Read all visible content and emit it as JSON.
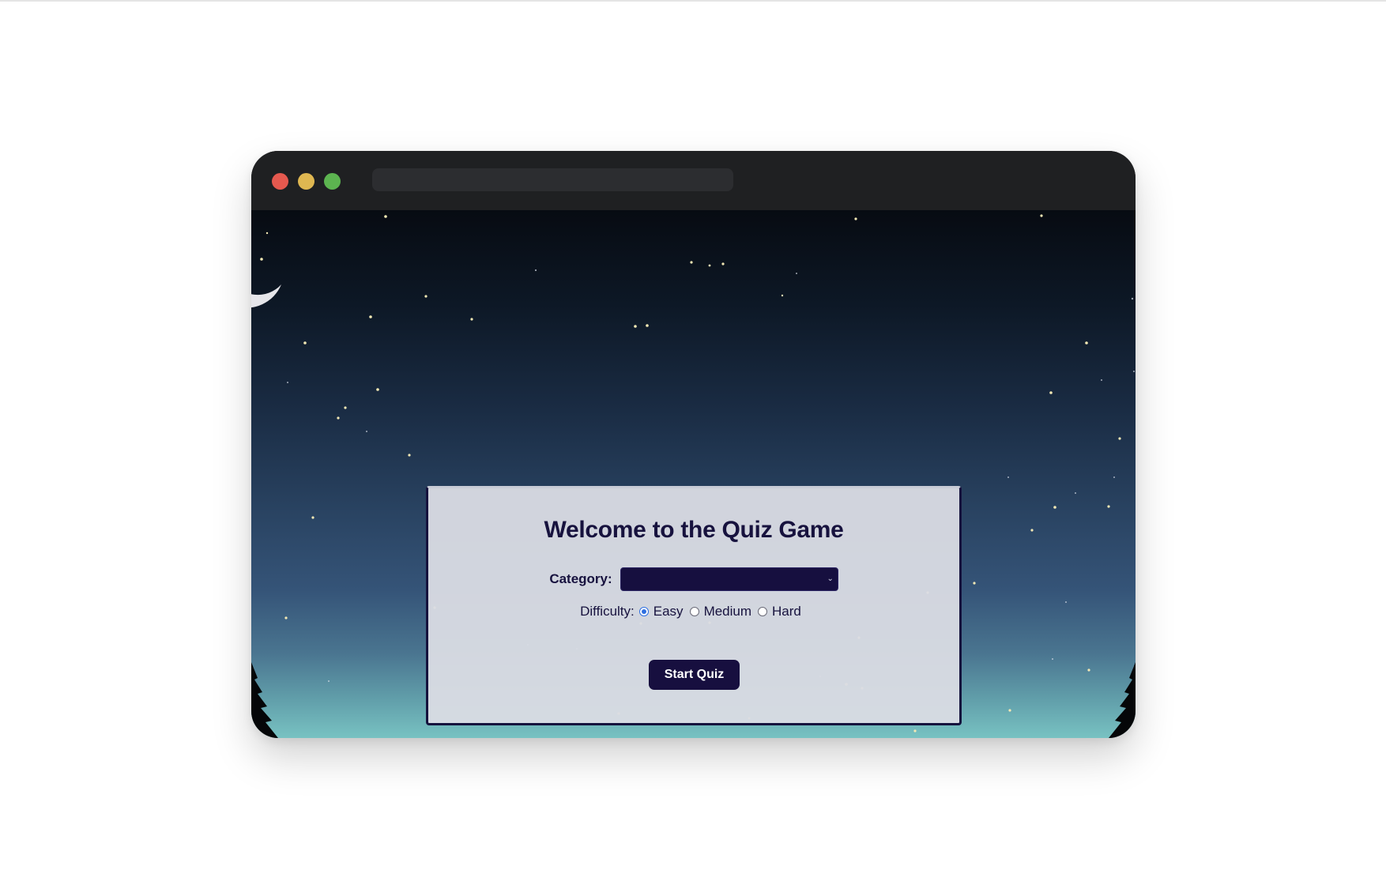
{
  "window": {
    "traffic_lights": [
      "close",
      "minimize",
      "maximize"
    ]
  },
  "quiz": {
    "title": "Welcome to the Quiz Game",
    "category_label": "Category:",
    "category_value": "",
    "difficulty_label": "Difficulty:",
    "difficulty_options": [
      "Easy",
      "Medium",
      "Hard"
    ],
    "difficulty_selected": "Easy",
    "start_button_label": "Start Quiz"
  },
  "colors": {
    "accent": "#170f3f",
    "card_background": "#dadce4",
    "radio_accent": "#2f6fe0"
  },
  "icons": {
    "moon": "crescent-moon-icon",
    "trees": "pine-tree-icon",
    "select_arrow": "chevron-down-icon"
  }
}
